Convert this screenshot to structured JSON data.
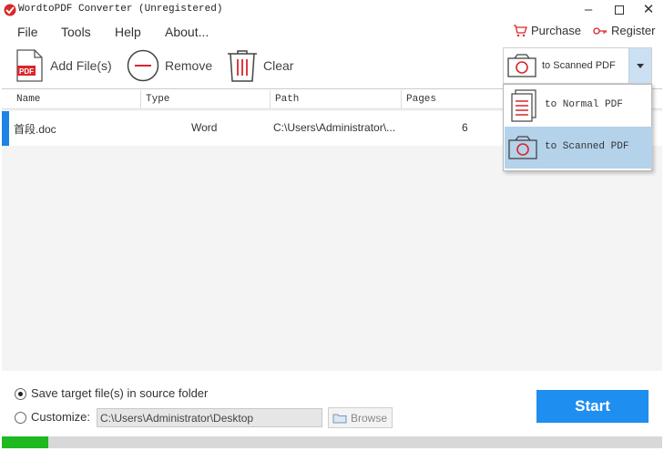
{
  "window": {
    "title": "WordtoPDF Converter (Unregistered)",
    "app_icon": "app-logo-icon",
    "controls": [
      "minimize-icon",
      "maximize-icon",
      "close-icon"
    ]
  },
  "menu": {
    "items": [
      "File",
      "Tools",
      "Help",
      "About..."
    ]
  },
  "header_links": {
    "purchase_label": "Purchase",
    "register_label": "Register"
  },
  "toolbar": {
    "add_label": "Add File(s)",
    "remove_label": "Remove",
    "clear_label": "Clear",
    "mode_label": "to Scanned PDF"
  },
  "table": {
    "columns": [
      "Name",
      "Type",
      "Path",
      "Pages"
    ],
    "rows": [
      {
        "name": "首段.doc",
        "type": "Word",
        "path": "C:\\Users\\Administrator\\...",
        "pages": "6"
      }
    ]
  },
  "dropdown": {
    "options": [
      "to Normal PDF",
      "to Scanned PDF"
    ],
    "selected": "to Scanned PDF"
  },
  "output": {
    "source_folder_label": "Save target file(s) in source folder",
    "customize_label": "Customize:",
    "path_value": "C:\\Users\\Administrator\\Desktop",
    "browse_label": "Browse",
    "source_folder_checked": true,
    "customize_checked": false
  },
  "start_label": "Start",
  "progress": {
    "value": 0.07
  },
  "colors": {
    "accent_blue": "#1e8ef0",
    "selection_blue": "#b4d2ea",
    "progress_green": "#1fb81f",
    "icon_red": "#d9262b"
  }
}
